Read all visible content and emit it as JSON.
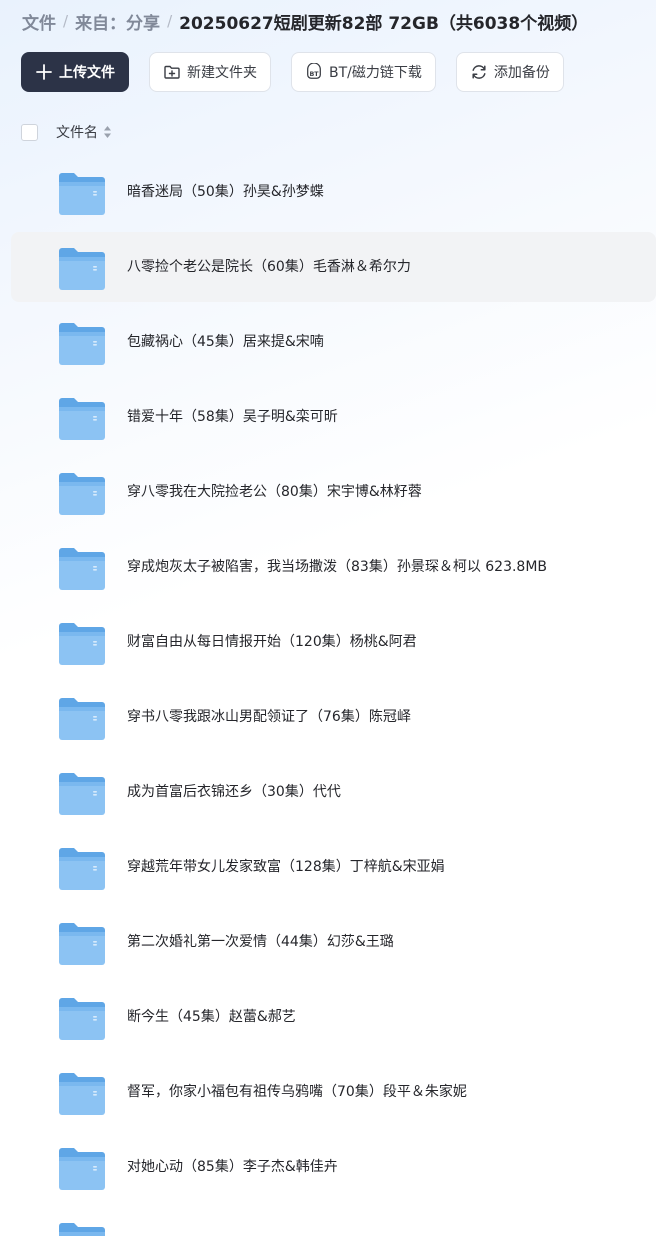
{
  "breadcrumb": {
    "root": "文件",
    "parent": "来自：分享",
    "current": "20250627短剧更新82部 72GB（共6038个视频）",
    "separator": "/"
  },
  "toolbar": {
    "upload_label": "上传文件",
    "new_folder_label": "新建文件夹",
    "bt_label": "BT/磁力链下载",
    "backup_label": "添加备份"
  },
  "list": {
    "name_header": "文件名",
    "hovered_index": 1,
    "items": [
      {
        "name": "暗香迷局（50集）孙昊&孙梦蝶"
      },
      {
        "name": "八零捡个老公是院长（60集）毛香淋＆希尔力"
      },
      {
        "name": "包藏祸心（45集）居来提&宋喃"
      },
      {
        "name": "错爱十年（58集）吴子明&栾可昕"
      },
      {
        "name": "穿八零我在大院捡老公（80集）宋宇博&林籽蓉"
      },
      {
        "name": "穿成炮灰太子被陷害，我当场撒泼（83集）孙景琛＆柯以 623.8MB"
      },
      {
        "name": "财富自由从每日情报开始（120集）杨桃&阿君"
      },
      {
        "name": "穿书八零我跟冰山男配领证了（76集）陈冠峄"
      },
      {
        "name": "成为首富后衣锦还乡（30集）代代"
      },
      {
        "name": "穿越荒年带女儿发家致富（128集）丁梓航&宋亚娟"
      },
      {
        "name": "第二次婚礼第一次爱情（44集）幻莎&王璐"
      },
      {
        "name": "断今生（45集）赵蕾&郝艺"
      },
      {
        "name": "督军，你家小福包有祖传乌鸦嘴（70集）段平＆朱家妮"
      },
      {
        "name": "对她心动（85集）李子杰&韩佳卉"
      },
      {
        "name": ""
      }
    ]
  },
  "colors": {
    "primary_button": "#2c3347",
    "folder_blue": "#6aaeea",
    "hover_row": "#f2f3f5"
  }
}
